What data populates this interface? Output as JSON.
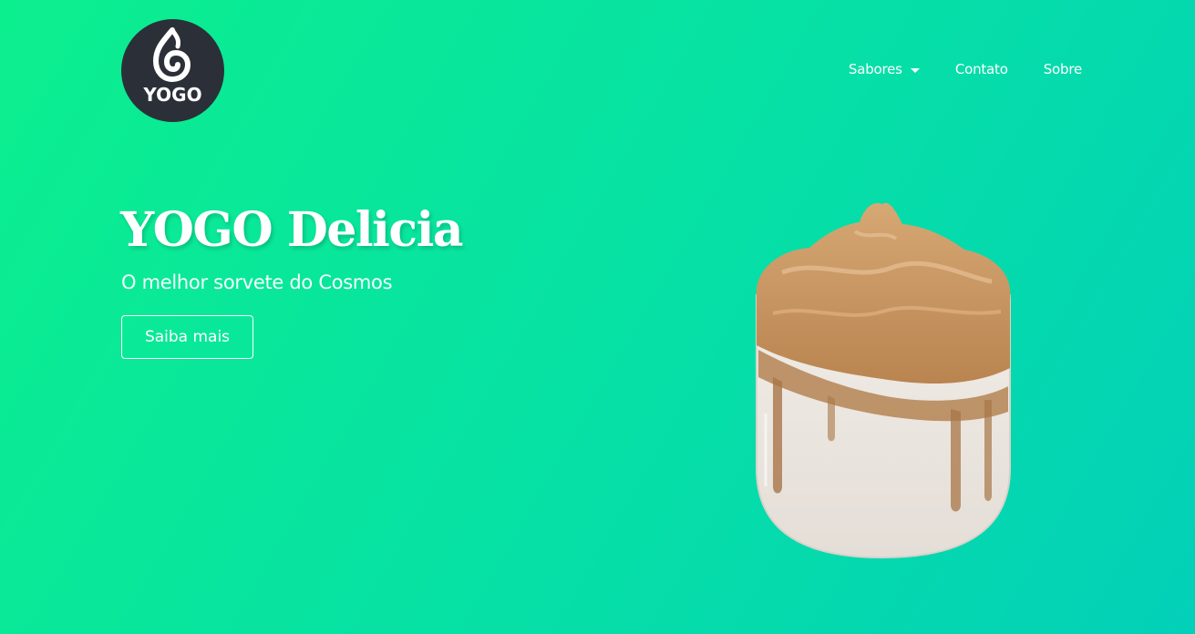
{
  "brand": {
    "logo_text": "YOGO",
    "logo_bg": "#2b3038"
  },
  "nav": {
    "items": [
      {
        "label": "Sabores",
        "has_dropdown": true
      },
      {
        "label": "Contato"
      },
      {
        "label": "Sobre"
      }
    ]
  },
  "hero": {
    "title": "YOGO Delicia",
    "subtitle": "O melhor sorvete do Cosmos",
    "cta_label": "Saiba mais"
  },
  "colors": {
    "bg_start": "#0cef8e",
    "bg_end": "#03d0b8",
    "text": "#ffffff"
  },
  "images": {
    "product": "dalgona-coffee-glass"
  }
}
